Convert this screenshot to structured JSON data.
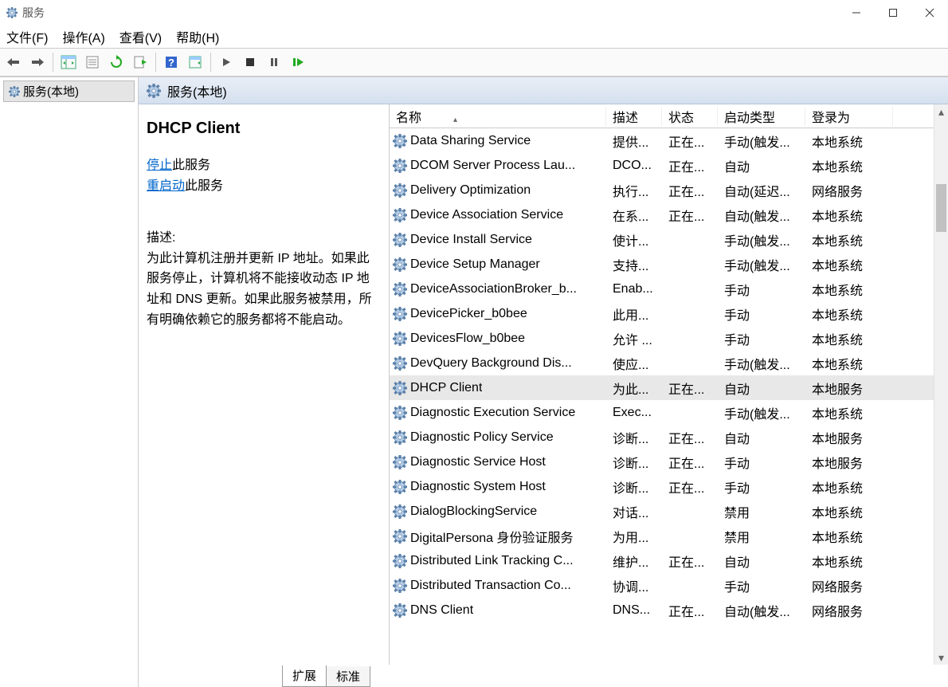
{
  "window": {
    "title": "服务"
  },
  "menu": {
    "file": "文件(F)",
    "action": "操作(A)",
    "view": "查看(V)",
    "help": "帮助(H)"
  },
  "tree": {
    "root": "服务(本地)"
  },
  "header": {
    "title": "服务(本地)"
  },
  "detail": {
    "service_name": "DHCP Client",
    "stop_label": "停止",
    "stop_suffix": "此服务",
    "restart_label": "重启动",
    "restart_suffix": "此服务",
    "desc_label": "描述:",
    "desc_text": "为此计算机注册并更新 IP 地址。如果此服务停止，计算机将不能接收动态 IP 地址和 DNS 更新。如果此服务被禁用，所有明确依赖它的服务都将不能启动。"
  },
  "columns": {
    "name": "名称",
    "desc": "描述",
    "status": "状态",
    "startup": "启动类型",
    "logon": "登录为"
  },
  "services": [
    {
      "name": "Data Sharing Service",
      "desc": "提供...",
      "status": "正在...",
      "startup": "手动(触发...",
      "logon": "本地系统",
      "selected": false
    },
    {
      "name": "DCOM Server Process Lau...",
      "desc": "DCO...",
      "status": "正在...",
      "startup": "自动",
      "logon": "本地系统",
      "selected": false
    },
    {
      "name": "Delivery Optimization",
      "desc": "执行...",
      "status": "正在...",
      "startup": "自动(延迟...",
      "logon": "网络服务",
      "selected": false
    },
    {
      "name": "Device Association Service",
      "desc": "在系...",
      "status": "正在...",
      "startup": "自动(触发...",
      "logon": "本地系统",
      "selected": false
    },
    {
      "name": "Device Install Service",
      "desc": "使计...",
      "status": "",
      "startup": "手动(触发...",
      "logon": "本地系统",
      "selected": false
    },
    {
      "name": "Device Setup Manager",
      "desc": "支持...",
      "status": "",
      "startup": "手动(触发...",
      "logon": "本地系统",
      "selected": false
    },
    {
      "name": "DeviceAssociationBroker_b...",
      "desc": "Enab...",
      "status": "",
      "startup": "手动",
      "logon": "本地系统",
      "selected": false
    },
    {
      "name": "DevicePicker_b0bee",
      "desc": "此用...",
      "status": "",
      "startup": "手动",
      "logon": "本地系统",
      "selected": false
    },
    {
      "name": "DevicesFlow_b0bee",
      "desc": "允许 ...",
      "status": "",
      "startup": "手动",
      "logon": "本地系统",
      "selected": false
    },
    {
      "name": "DevQuery Background Dis...",
      "desc": "使应...",
      "status": "",
      "startup": "手动(触发...",
      "logon": "本地系统",
      "selected": false
    },
    {
      "name": "DHCP Client",
      "desc": "为此...",
      "status": "正在...",
      "startup": "自动",
      "logon": "本地服务",
      "selected": true
    },
    {
      "name": "Diagnostic Execution Service",
      "desc": "Exec...",
      "status": "",
      "startup": "手动(触发...",
      "logon": "本地系统",
      "selected": false
    },
    {
      "name": "Diagnostic Policy Service",
      "desc": "诊断...",
      "status": "正在...",
      "startup": "自动",
      "logon": "本地服务",
      "selected": false
    },
    {
      "name": "Diagnostic Service Host",
      "desc": "诊断...",
      "status": "正在...",
      "startup": "手动",
      "logon": "本地服务",
      "selected": false
    },
    {
      "name": "Diagnostic System Host",
      "desc": "诊断...",
      "status": "正在...",
      "startup": "手动",
      "logon": "本地系统",
      "selected": false
    },
    {
      "name": "DialogBlockingService",
      "desc": "对话...",
      "status": "",
      "startup": "禁用",
      "logon": "本地系统",
      "selected": false
    },
    {
      "name": "DigitalPersona 身份验证服务",
      "desc": "为用...",
      "status": "",
      "startup": "禁用",
      "logon": "本地系统",
      "selected": false
    },
    {
      "name": "Distributed Link Tracking C...",
      "desc": "维护...",
      "status": "正在...",
      "startup": "自动",
      "logon": "本地系统",
      "selected": false
    },
    {
      "name": "Distributed Transaction Co...",
      "desc": "协调...",
      "status": "",
      "startup": "手动",
      "logon": "网络服务",
      "selected": false
    },
    {
      "name": "DNS Client",
      "desc": "DNS...",
      "status": "正在...",
      "startup": "自动(触发...",
      "logon": "网络服务",
      "selected": false
    }
  ],
  "tabs": {
    "extended": "扩展",
    "standard": "标准"
  }
}
